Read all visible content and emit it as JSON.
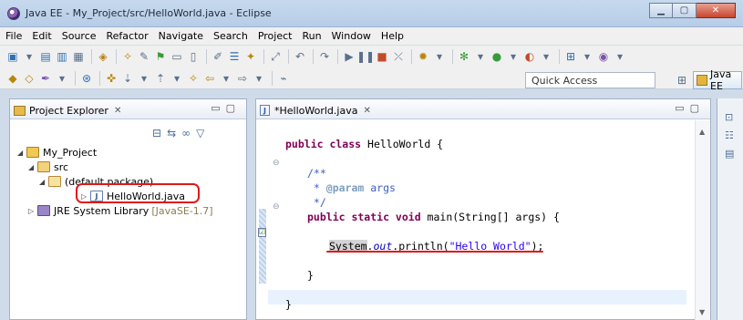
{
  "window": {
    "title": "Java EE - My_Project/src/HelloWorld.java - Eclipse"
  },
  "menu": [
    "File",
    "Edit",
    "Source",
    "Refactor",
    "Navigate",
    "Search",
    "Project",
    "Run",
    "Window",
    "Help"
  ],
  "toolbar": {
    "quick_access": "Quick Access",
    "perspective": "Java EE"
  },
  "project_explorer": {
    "title": "Project Explorer",
    "tree": [
      {
        "label": "My_Project"
      },
      {
        "label": "src"
      },
      {
        "label": "(default package)"
      },
      {
        "label": "HelloWorld.java"
      },
      {
        "label": "JRE System Library",
        "suffix": "[JavaSE-1.7]"
      }
    ]
  },
  "editor": {
    "tab": "*HelloWorld.java",
    "code": {
      "l1_kw": "public class",
      "l1_rest": " HelloWorld {",
      "l3": "/**",
      "l4_pre": " * ",
      "l4_tag": "@param",
      "l4_rest": " args",
      "l5": " */",
      "l6_kw1": "public static void",
      "l6_rest": " main(String[] args) {",
      "l8_sys": "System",
      "l8_dot": ".",
      "l8_out": "out",
      "l8_mid": ".println(",
      "l8_str": "\"Hello World\"",
      "l8_end": ");",
      "l10": "}",
      "l12": "}"
    }
  }
}
